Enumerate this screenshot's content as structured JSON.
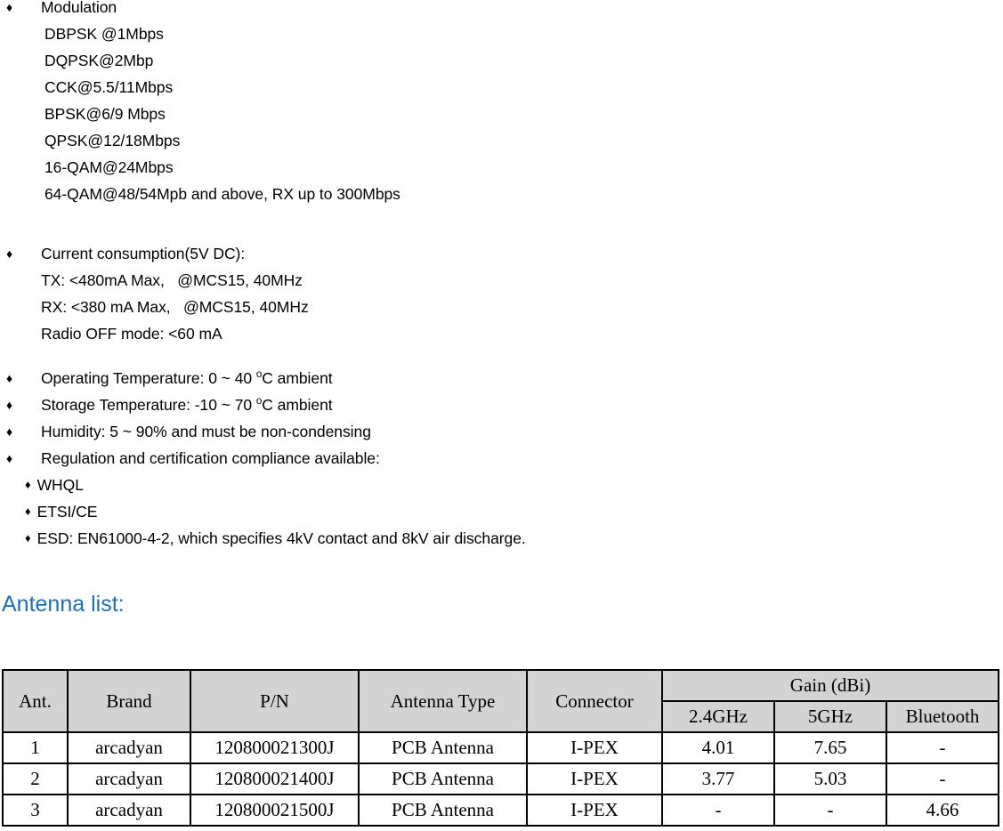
{
  "specs": {
    "modulation": {
      "bullet_label": "Modulation",
      "lines": [
        "DBPSK @1Mbps",
        "DQPSK@2Mbp",
        "CCK@5.5/11Mbps",
        "BPSK@6/9 Mbps",
        "QPSK@12/18Mbps",
        "16-QAM@24Mbps",
        "64-QAM@48/54Mpb and above, RX up to 300Mbps"
      ]
    },
    "current_consumption": {
      "bullet_label": "Current consumption(5V DC):",
      "lines": [
        "TX: <480mA Max,   @MCS15, 40MHz",
        "RX: <380 mA Max,   @MCS15, 40MHz",
        "Radio OFF mode: <60 mA"
      ]
    },
    "environment": {
      "operating_temperature_pre": "Operating Temperature: 0 ~ 40 ",
      "operating_temperature_post": "C ambient",
      "storage_temperature_pre": "Storage Temperature: -10 ~ 70 ",
      "storage_temperature_post": "C ambient",
      "degree_symbol": "o",
      "humidity": "Humidity: 5 ~ 90% and must be non-condensing",
      "regulation": "Regulation and certification compliance available:",
      "certifications": [
        "WHQL",
        "ETSI/CE",
        "ESD: EN61000-4-2, which specifies 4kV contact and 8kV air discharge."
      ]
    },
    "bullet_glyph": "♦"
  },
  "antenna_section": {
    "heading": "Antenna list:",
    "heading_color": "#1F6FB5",
    "table": {
      "header_bg": "#d3d3d3",
      "columns": [
        "Ant.",
        "Brand",
        "P/N",
        "Antenna Type",
        "Connector"
      ],
      "group_header": "Gain (dBi)",
      "group_subcolumns": [
        "2.4GHz",
        "5GHz",
        "Bluetooth"
      ],
      "rows": [
        {
          "ant": "1",
          "brand": "arcadyan",
          "pn": "120800021300J",
          "type": "PCB Antenna",
          "connector": "I-PEX",
          "gain_24ghz": "4.01",
          "gain_5ghz": "7.65",
          "gain_bluetooth": "-"
        },
        {
          "ant": "2",
          "brand": "arcadyan",
          "pn": "120800021400J",
          "type": "PCB Antenna",
          "connector": "I-PEX",
          "gain_24ghz": "3.77",
          "gain_5ghz": "5.03",
          "gain_bluetooth": "-"
        },
        {
          "ant": "3",
          "brand": "arcadyan",
          "pn": "120800021500J",
          "type": "PCB Antenna",
          "connector": "I-PEX",
          "gain_24ghz": "-",
          "gain_5ghz": "-",
          "gain_bluetooth": "4.66"
        }
      ]
    }
  }
}
